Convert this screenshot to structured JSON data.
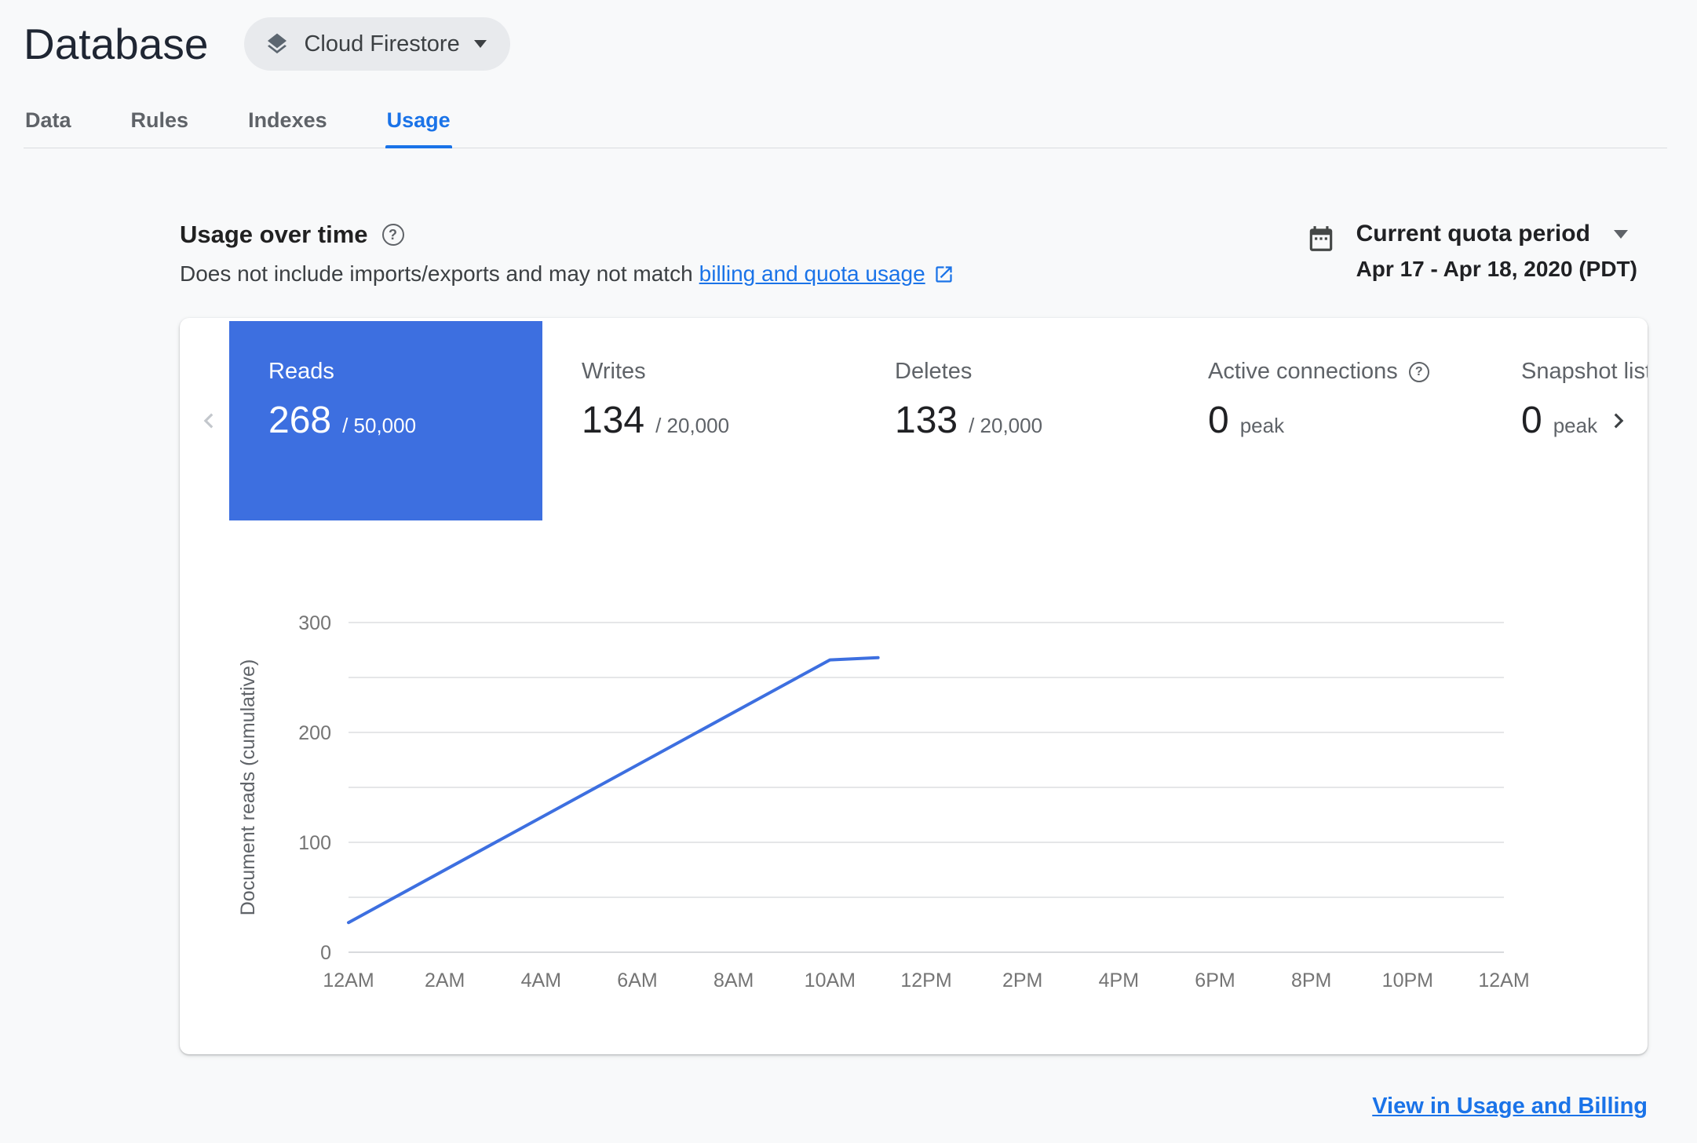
{
  "header": {
    "title": "Database",
    "product_selector": {
      "label": "Cloud Firestore"
    }
  },
  "tabs": [
    {
      "label": "Data",
      "active": false
    },
    {
      "label": "Rules",
      "active": false
    },
    {
      "label": "Indexes",
      "active": false
    },
    {
      "label": "Usage",
      "active": true
    }
  ],
  "usage_section": {
    "heading": "Usage over time",
    "description_prefix": "Does not include imports/exports and may not match",
    "description_link": "billing and quota usage",
    "quota_period": {
      "label": "Current quota period",
      "range": "Apr 17 - Apr 18, 2020 (PDT)"
    }
  },
  "metrics": [
    {
      "name": "Reads",
      "value": "268",
      "limit": "/ 50,000",
      "selected": true
    },
    {
      "name": "Writes",
      "value": "134",
      "limit": "/ 20,000",
      "selected": false
    },
    {
      "name": "Deletes",
      "value": "133",
      "limit": "/ 20,000",
      "selected": false
    },
    {
      "name": "Active connections",
      "value": "0",
      "limit": "peak",
      "selected": false,
      "has_help": true
    },
    {
      "name": "Snapshot listeners",
      "value": "0",
      "limit": "peak",
      "selected": false
    }
  ],
  "chart_data": {
    "type": "line",
    "title": "",
    "xlabel": "",
    "ylabel": "Document reads (cumulative)",
    "x_ticks": [
      "12AM",
      "2AM",
      "4AM",
      "6AM",
      "8AM",
      "10AM",
      "12PM",
      "2PM",
      "4PM",
      "6PM",
      "8PM",
      "10PM",
      "12AM"
    ],
    "xlim": [
      0,
      24
    ],
    "ylim": [
      0,
      300
    ],
    "y_ticks": [
      0,
      100,
      200,
      300
    ],
    "grid_step": 50,
    "legend": false,
    "series": [
      {
        "name": "Document reads (cumulative)",
        "color": "#3d6fe0",
        "points": [
          {
            "x": 0,
            "y": 27
          },
          {
            "x": 10,
            "y": 266
          },
          {
            "x": 11,
            "y": 268
          }
        ]
      }
    ]
  },
  "footer": {
    "link_label": "View in Usage and Billing"
  },
  "colors": {
    "accent_blue": "#1a73e8",
    "tile_blue": "#3d6fe0",
    "page_bg": "#f8f9fa"
  }
}
